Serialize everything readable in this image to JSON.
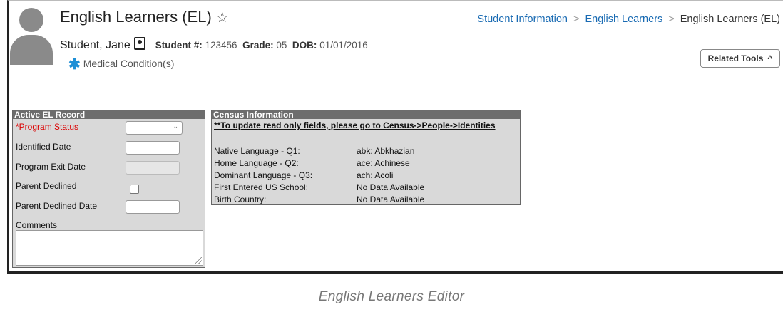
{
  "page": {
    "title": "English Learners (EL)",
    "star_glyph": "☆",
    "breadcrumb": [
      "Student Information",
      "English Learners",
      "English Learners (EL)"
    ]
  },
  "student": {
    "name": "Student, Jane",
    "student_number_label": "Student #:",
    "student_number": "123456",
    "grade_label": "Grade:",
    "grade": "05",
    "dob_label": "DOB:",
    "dob": "01/01/2016",
    "medical": "Medical Condition(s)"
  },
  "toolbar": {
    "related_tools": "Related Tools"
  },
  "el_record": {
    "header": "Active EL Record",
    "program_status": "*Program Status",
    "identified_date": "Identified Date",
    "program_exit_date": "Program Exit Date",
    "parent_declined": "Parent Declined",
    "parent_declined_date": "Parent Declined Date",
    "comments": "Comments"
  },
  "census": {
    "header": "Census Information",
    "notice": "**To update read only fields, please go to Census->People->Identities",
    "rows": [
      {
        "label": "Native Language - Q1:",
        "value": "abk: Abkhazian"
      },
      {
        "label": "Home Language - Q2:",
        "value": "ace: Achinese"
      },
      {
        "label": "Dominant Language - Q3:",
        "value": "ach: Acoli"
      },
      {
        "label": "First Entered US School:",
        "value": "No Data Available"
      },
      {
        "label": "Birth Country:",
        "value": "No Data Available"
      }
    ]
  },
  "caption": "English Learners Editor",
  "colors": {
    "link": "#1a6bb3",
    "required": "#dd0000",
    "panel_header": "#6d6d6d",
    "panel_bg": "#d9d9d9"
  }
}
